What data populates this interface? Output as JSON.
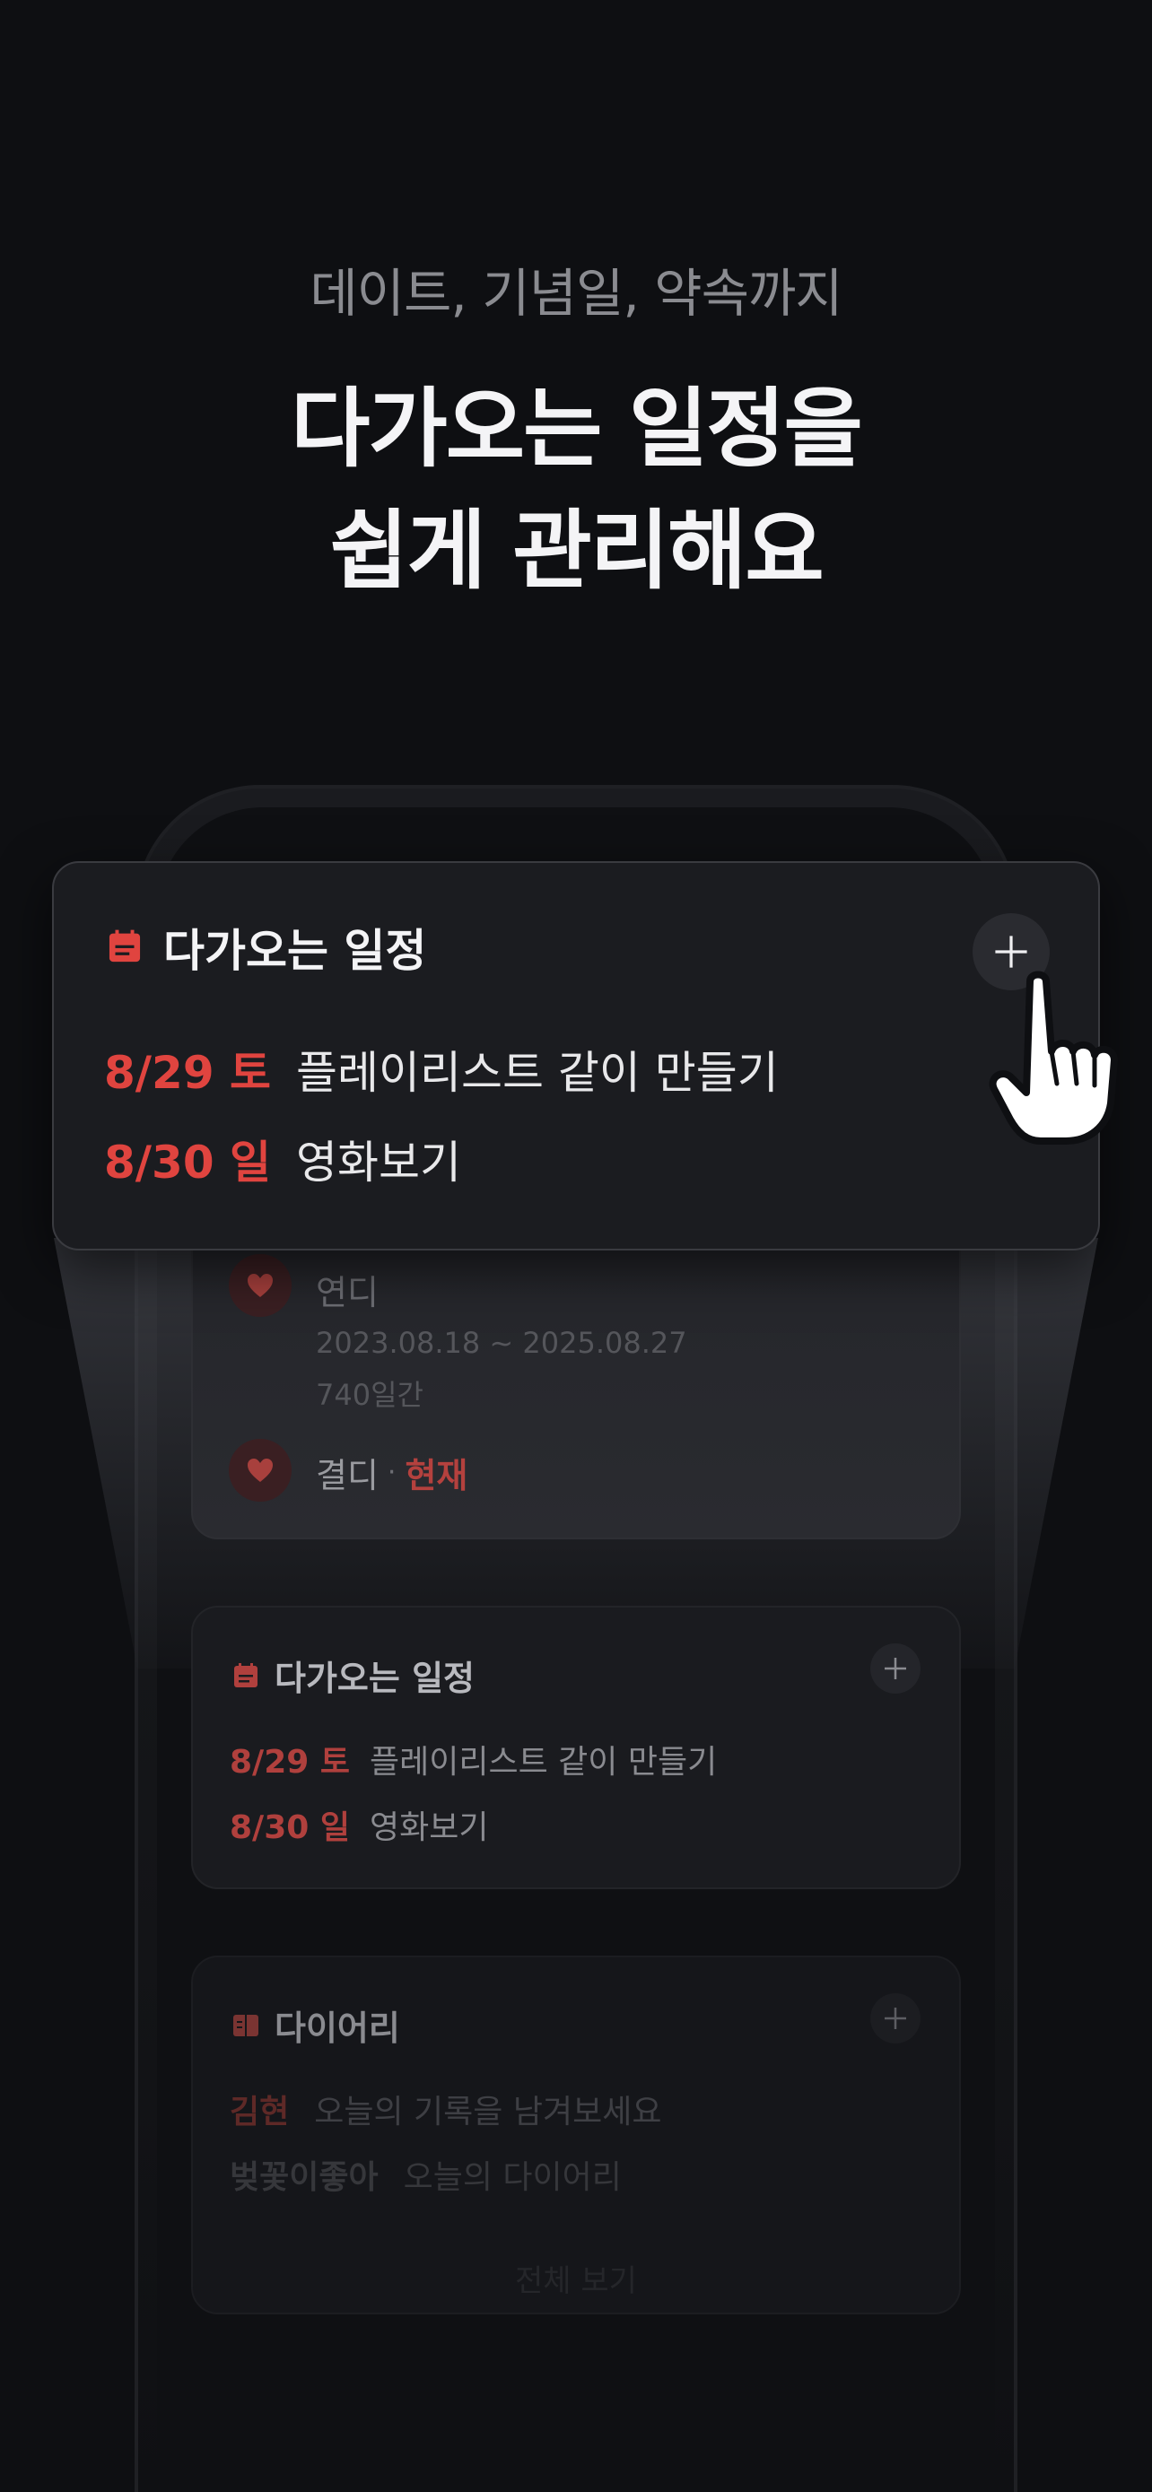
{
  "hero": {
    "eyebrow": "데이트, 기념일, 약속까지",
    "headline_line1": "다가오는 일정을",
    "headline_line2": "쉽게 관리해요"
  },
  "popup_card": {
    "title": "다가오는 일정",
    "icon": "calendar-icon",
    "add_icon": "plus-icon",
    "items": [
      {
        "date": "8/29 토",
        "title": "플레이리스트 같이 만들기"
      },
      {
        "date": "8/30 일",
        "title": "영화보기"
      }
    ]
  },
  "anniversary_card": {
    "entries": [
      {
        "name": "연디",
        "range": "2023.08.18 ~ 2025.08.27",
        "days": "740일간"
      },
      {
        "name": "결디",
        "status_separator": "·",
        "status": "현재"
      }
    ]
  },
  "schedule_card": {
    "title": "다가오는 일정",
    "items": [
      {
        "date": "8/29 토",
        "title": "플레이리스트 같이 만들기"
      },
      {
        "date": "8/30 일",
        "title": "영화보기"
      }
    ]
  },
  "diary_card": {
    "title": "다이어리",
    "items": [
      {
        "author": "김현",
        "text": "오늘의 기록을 남겨보세요"
      },
      {
        "author": "벚꽃이좋아",
        "text": "오늘의 다이어리"
      }
    ],
    "see_all": "전체 보기"
  },
  "colors": {
    "accent": "#e0443f",
    "background": "#0e0f12",
    "card": "#1b1c20"
  }
}
